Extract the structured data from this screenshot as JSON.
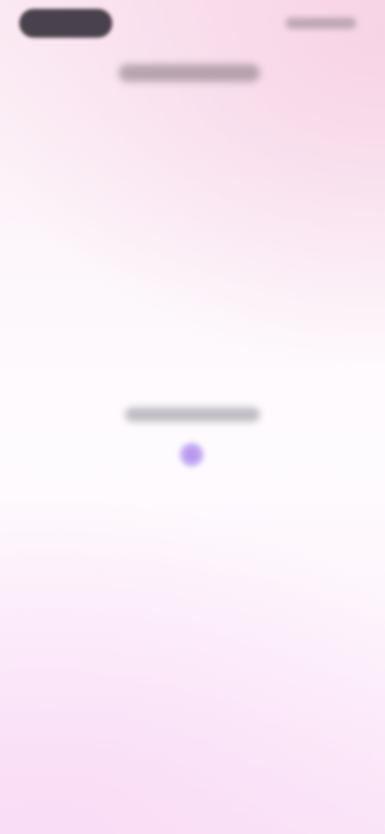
{
  "status_bar": {},
  "header": {},
  "loading": {
    "indicator": "spinner"
  },
  "colors": {
    "accent": "#a67ce8",
    "background_top": "#f7d3e6",
    "background_bottom": "#fbe6f8"
  }
}
